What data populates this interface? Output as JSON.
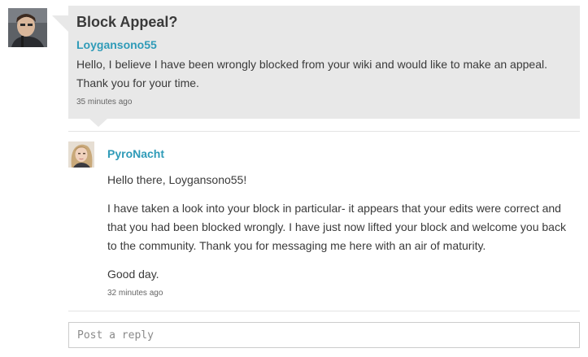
{
  "thread": {
    "title": "Block Appeal?",
    "author": "Loygansono55",
    "body": [
      "Hello, I believe I have been wrongly blocked from your wiki and would like to make an appeal.",
      "Thank you for your time."
    ],
    "timestamp": "35 minutes ago"
  },
  "reply": {
    "author": "PyroNacht",
    "body": [
      "Hello there, Loygansono55!",
      "I have taken a look into your block in particular- it appears that your edits were correct and that you had been blocked wrongly. I have just now lifted your block and welcome you back to the community. Thank you for messaging me here with an air of maturity.",
      "Good day."
    ],
    "timestamp": "32 minutes ago"
  },
  "composer": {
    "placeholder": "Post a reply"
  },
  "colors": {
    "link": "#2f9bb8",
    "bubble": "#e8e8e8",
    "text": "#3a3a3a"
  }
}
